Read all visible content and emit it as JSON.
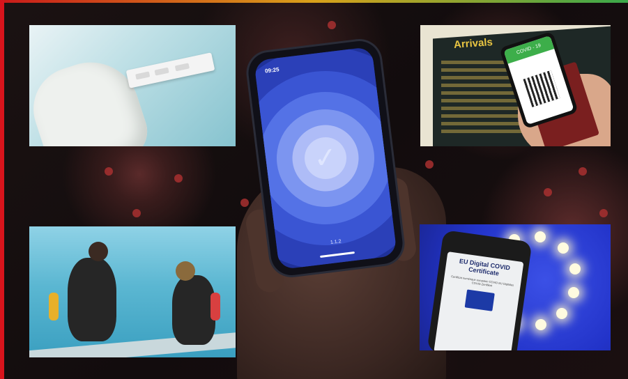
{
  "phone": {
    "time": "09:25",
    "version": "1.1.2"
  },
  "arrivals_panel": {
    "board_title": "Arrivals",
    "certificate_header": "COVID - 19"
  },
  "eu_panel": {
    "certificate_title": "EU Digital COVID Certificate",
    "certificate_subtext": "Certificat numérique européen COVID EU Digitales COVID-Zertifikat"
  },
  "colors": {
    "accent_red": "#d8141c",
    "screen_blue": "#1f3199",
    "eu_blue": "#2233c9"
  }
}
